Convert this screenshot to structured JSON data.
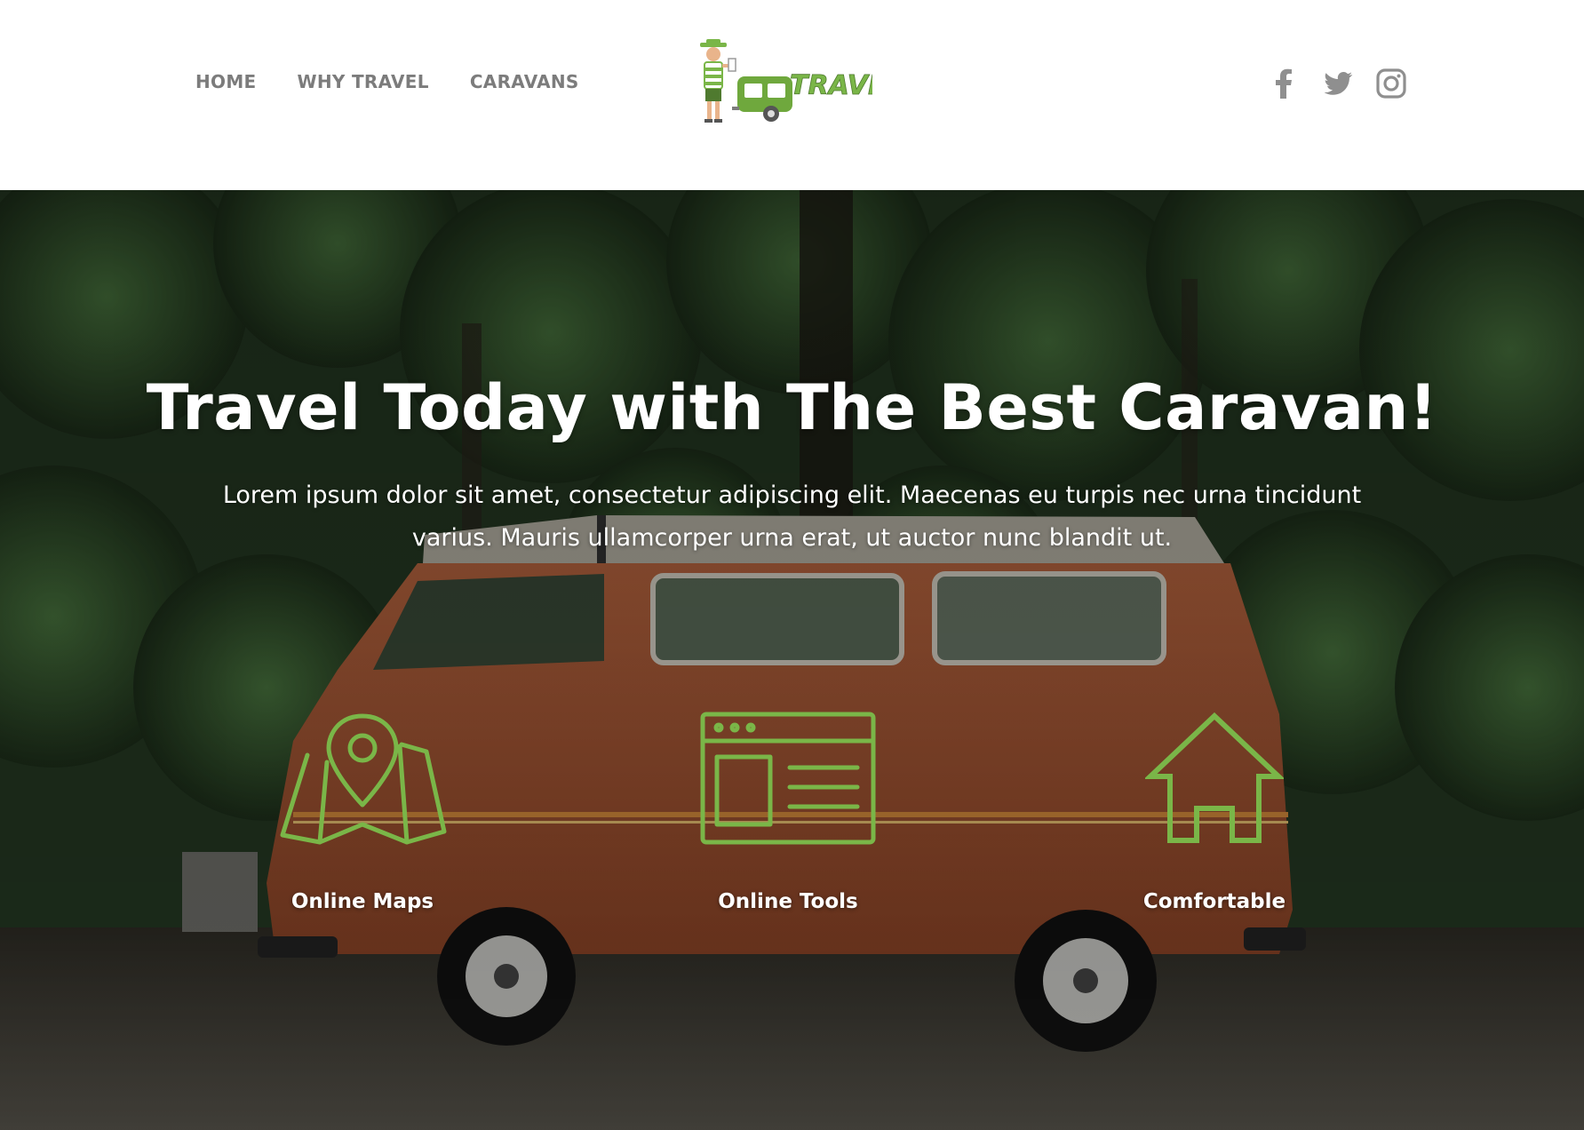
{
  "header": {
    "nav": [
      {
        "label": "HOME"
      },
      {
        "label": "WHY TRAVEL"
      },
      {
        "label": "CARAVANS"
      }
    ],
    "logo_text": "TRAVEL",
    "social_icons": [
      "facebook-icon",
      "twitter-icon",
      "instagram-icon"
    ]
  },
  "hero": {
    "title": "Travel Today with The Best Caravan!",
    "subtitle": "Lorem ipsum dolor sit amet, consectetur adipiscing elit. Maecenas eu turpis nec urna tincidunt varius. Mauris ullamcorper urna erat, ut auctor nunc blandit ut.",
    "features": [
      {
        "label": "Online Maps",
        "icon": "map-pin-icon"
      },
      {
        "label": "Online Tools",
        "icon": "browser-window-icon"
      },
      {
        "label": "Comfortable",
        "icon": "house-icon"
      }
    ]
  },
  "colors": {
    "accent_green": "#7ab648",
    "nav_gray": "#7c7c7c",
    "van_body": "#a85a38"
  }
}
